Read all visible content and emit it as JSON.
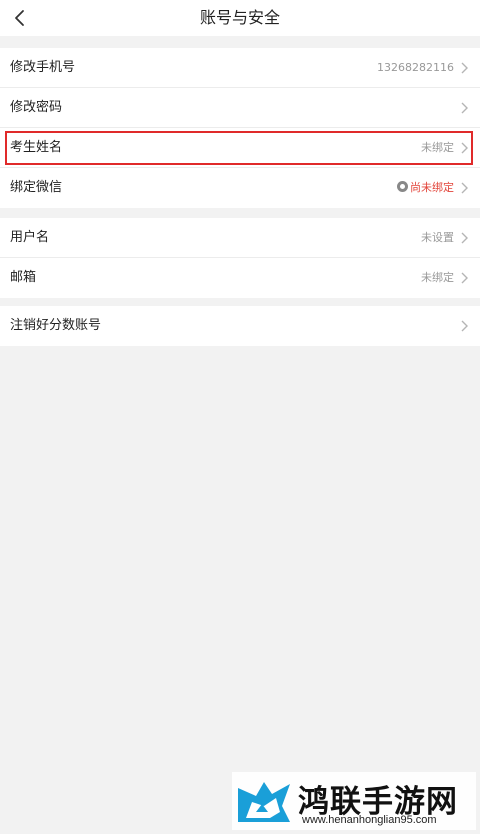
{
  "header": {
    "title": "账号与安全"
  },
  "groups": [
    {
      "rows": [
        {
          "label": "修改手机号",
          "value": "13268282116"
        },
        {
          "label": "修改密码",
          "value": ""
        },
        {
          "label": "考生姓名",
          "value": "未绑定"
        },
        {
          "label": "绑定微信",
          "value": "尚未绑定"
        }
      ]
    },
    {
      "rows": [
        {
          "label": "用户名",
          "value": "未设置"
        },
        {
          "label": "邮箱",
          "value": "未绑定"
        }
      ]
    },
    {
      "rows": [
        {
          "label": "注销好分数账号",
          "value": ""
        }
      ]
    }
  ],
  "watermark": {
    "name": "鸿联手游网",
    "url": "www.henanhonglian95.com"
  },
  "colors": {
    "highlight_border": "#e02a2a",
    "unbound_red": "#e2453b",
    "background": "#f2f2f2"
  },
  "icons": [
    "back-arrow-icon",
    "chevron-right-icon",
    "wechat-icon",
    "watermark-logo-icon"
  ]
}
